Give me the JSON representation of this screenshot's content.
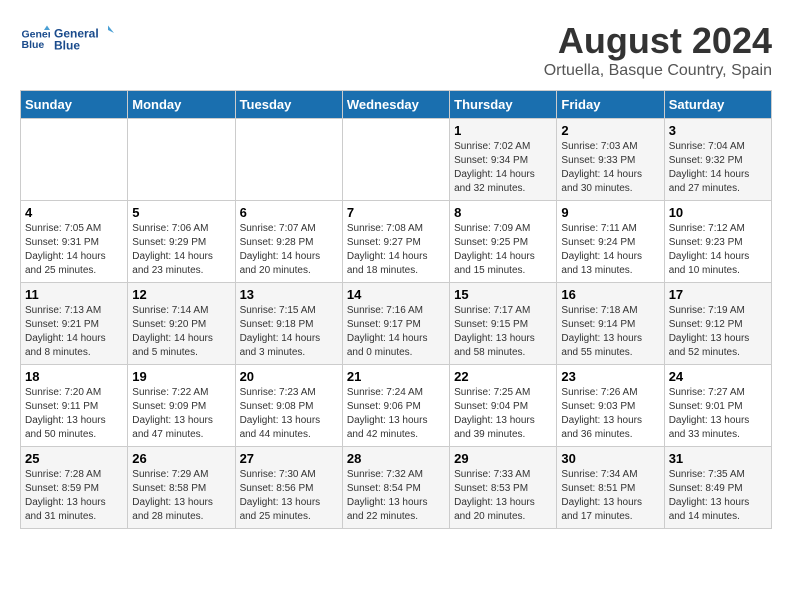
{
  "logo": {
    "line1": "General",
    "line2": "Blue"
  },
  "title": "August 2024",
  "subtitle": "Ortuella, Basque Country, Spain",
  "days_of_week": [
    "Sunday",
    "Monday",
    "Tuesday",
    "Wednesday",
    "Thursday",
    "Friday",
    "Saturday"
  ],
  "weeks": [
    [
      {
        "day": "",
        "content": ""
      },
      {
        "day": "",
        "content": ""
      },
      {
        "day": "",
        "content": ""
      },
      {
        "day": "",
        "content": ""
      },
      {
        "day": "1",
        "content": "Sunrise: 7:02 AM\nSunset: 9:34 PM\nDaylight: 14 hours\nand 32 minutes."
      },
      {
        "day": "2",
        "content": "Sunrise: 7:03 AM\nSunset: 9:33 PM\nDaylight: 14 hours\nand 30 minutes."
      },
      {
        "day": "3",
        "content": "Sunrise: 7:04 AM\nSunset: 9:32 PM\nDaylight: 14 hours\nand 27 minutes."
      }
    ],
    [
      {
        "day": "4",
        "content": "Sunrise: 7:05 AM\nSunset: 9:31 PM\nDaylight: 14 hours\nand 25 minutes."
      },
      {
        "day": "5",
        "content": "Sunrise: 7:06 AM\nSunset: 9:29 PM\nDaylight: 14 hours\nand 23 minutes."
      },
      {
        "day": "6",
        "content": "Sunrise: 7:07 AM\nSunset: 9:28 PM\nDaylight: 14 hours\nand 20 minutes."
      },
      {
        "day": "7",
        "content": "Sunrise: 7:08 AM\nSunset: 9:27 PM\nDaylight: 14 hours\nand 18 minutes."
      },
      {
        "day": "8",
        "content": "Sunrise: 7:09 AM\nSunset: 9:25 PM\nDaylight: 14 hours\nand 15 minutes."
      },
      {
        "day": "9",
        "content": "Sunrise: 7:11 AM\nSunset: 9:24 PM\nDaylight: 14 hours\nand 13 minutes."
      },
      {
        "day": "10",
        "content": "Sunrise: 7:12 AM\nSunset: 9:23 PM\nDaylight: 14 hours\nand 10 minutes."
      }
    ],
    [
      {
        "day": "11",
        "content": "Sunrise: 7:13 AM\nSunset: 9:21 PM\nDaylight: 14 hours\nand 8 minutes."
      },
      {
        "day": "12",
        "content": "Sunrise: 7:14 AM\nSunset: 9:20 PM\nDaylight: 14 hours\nand 5 minutes."
      },
      {
        "day": "13",
        "content": "Sunrise: 7:15 AM\nSunset: 9:18 PM\nDaylight: 14 hours\nand 3 minutes."
      },
      {
        "day": "14",
        "content": "Sunrise: 7:16 AM\nSunset: 9:17 PM\nDaylight: 14 hours\nand 0 minutes."
      },
      {
        "day": "15",
        "content": "Sunrise: 7:17 AM\nSunset: 9:15 PM\nDaylight: 13 hours\nand 58 minutes."
      },
      {
        "day": "16",
        "content": "Sunrise: 7:18 AM\nSunset: 9:14 PM\nDaylight: 13 hours\nand 55 minutes."
      },
      {
        "day": "17",
        "content": "Sunrise: 7:19 AM\nSunset: 9:12 PM\nDaylight: 13 hours\nand 52 minutes."
      }
    ],
    [
      {
        "day": "18",
        "content": "Sunrise: 7:20 AM\nSunset: 9:11 PM\nDaylight: 13 hours\nand 50 minutes."
      },
      {
        "day": "19",
        "content": "Sunrise: 7:22 AM\nSunset: 9:09 PM\nDaylight: 13 hours\nand 47 minutes."
      },
      {
        "day": "20",
        "content": "Sunrise: 7:23 AM\nSunset: 9:08 PM\nDaylight: 13 hours\nand 44 minutes."
      },
      {
        "day": "21",
        "content": "Sunrise: 7:24 AM\nSunset: 9:06 PM\nDaylight: 13 hours\nand 42 minutes."
      },
      {
        "day": "22",
        "content": "Sunrise: 7:25 AM\nSunset: 9:04 PM\nDaylight: 13 hours\nand 39 minutes."
      },
      {
        "day": "23",
        "content": "Sunrise: 7:26 AM\nSunset: 9:03 PM\nDaylight: 13 hours\nand 36 minutes."
      },
      {
        "day": "24",
        "content": "Sunrise: 7:27 AM\nSunset: 9:01 PM\nDaylight: 13 hours\nand 33 minutes."
      }
    ],
    [
      {
        "day": "25",
        "content": "Sunrise: 7:28 AM\nSunset: 8:59 PM\nDaylight: 13 hours\nand 31 minutes."
      },
      {
        "day": "26",
        "content": "Sunrise: 7:29 AM\nSunset: 8:58 PM\nDaylight: 13 hours\nand 28 minutes."
      },
      {
        "day": "27",
        "content": "Sunrise: 7:30 AM\nSunset: 8:56 PM\nDaylight: 13 hours\nand 25 minutes."
      },
      {
        "day": "28",
        "content": "Sunrise: 7:32 AM\nSunset: 8:54 PM\nDaylight: 13 hours\nand 22 minutes."
      },
      {
        "day": "29",
        "content": "Sunrise: 7:33 AM\nSunset: 8:53 PM\nDaylight: 13 hours\nand 20 minutes."
      },
      {
        "day": "30",
        "content": "Sunrise: 7:34 AM\nSunset: 8:51 PM\nDaylight: 13 hours\nand 17 minutes."
      },
      {
        "day": "31",
        "content": "Sunrise: 7:35 AM\nSunset: 8:49 PM\nDaylight: 13 hours\nand 14 minutes."
      }
    ]
  ]
}
